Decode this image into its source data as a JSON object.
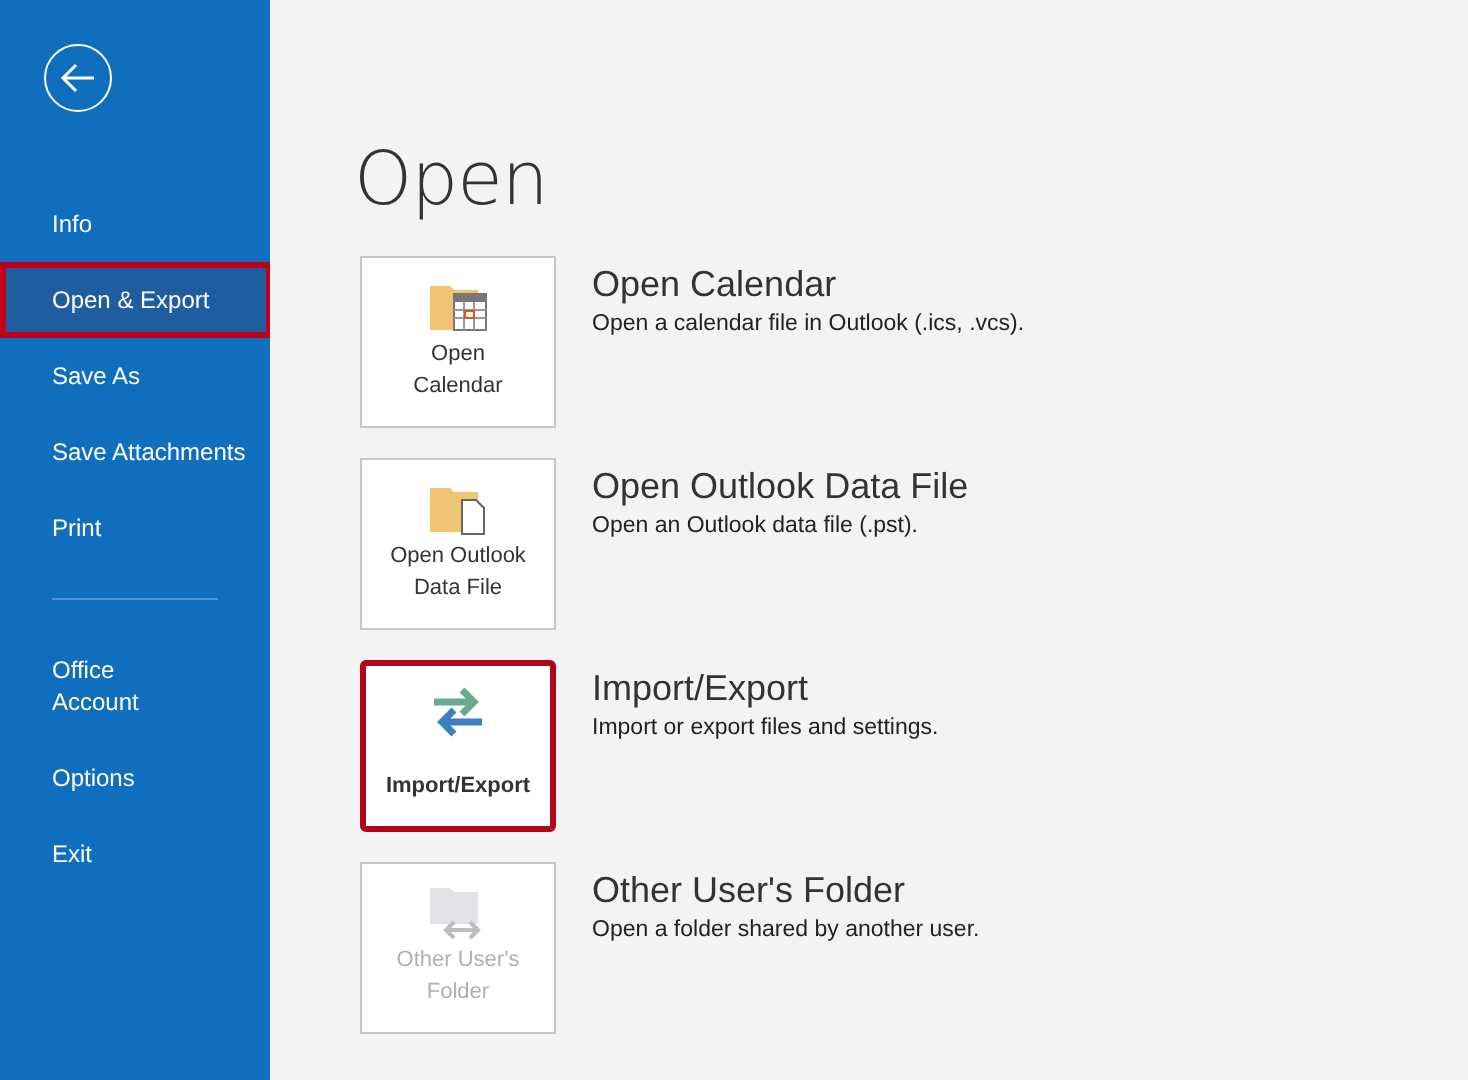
{
  "sidebar": {
    "items": [
      {
        "label": "Info",
        "selected": false,
        "highlighted": false
      },
      {
        "label": "Open & Export",
        "selected": true,
        "highlighted": true
      },
      {
        "label": "Save As",
        "selected": false,
        "highlighted": false
      },
      {
        "label": "Save Attachments",
        "selected": false,
        "highlighted": false
      },
      {
        "label": "Print",
        "selected": false,
        "highlighted": false
      },
      {
        "kind": "divider"
      },
      {
        "label": "Office\nAccount",
        "selected": false,
        "highlighted": false
      },
      {
        "label": "Options",
        "selected": false,
        "highlighted": false
      },
      {
        "label": "Exit",
        "selected": false,
        "highlighted": false
      }
    ]
  },
  "page": {
    "title": "Open",
    "options": [
      {
        "kind": "calendar",
        "tile_label": "Open\nCalendar",
        "title": "Open Calendar",
        "description": "Open a calendar file in Outlook (.ics, .vcs).",
        "disabled": false,
        "highlighted": false
      },
      {
        "kind": "datafile",
        "tile_label": "Open Outlook\nData File",
        "title": "Open Outlook Data File",
        "description": "Open an Outlook data file (.pst).",
        "disabled": false,
        "highlighted": false
      },
      {
        "kind": "importexport",
        "tile_label": "Import/Export",
        "title": "Import/Export",
        "description": "Import or export files and settings.",
        "disabled": false,
        "highlighted": true
      },
      {
        "kind": "shared",
        "tile_label": "Other User's\nFolder",
        "title": "Other User's Folder",
        "description": "Open a folder shared by another user.",
        "disabled": true,
        "highlighted": false
      }
    ]
  }
}
